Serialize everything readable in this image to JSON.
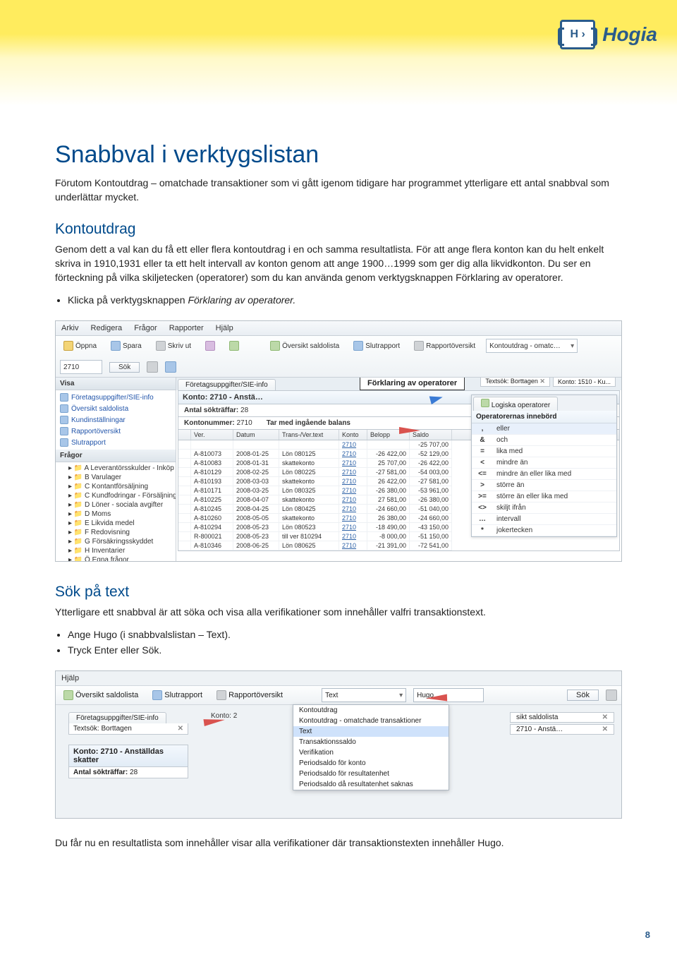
{
  "logo": {
    "brand": "Hogia",
    "mark": "H ›"
  },
  "page_number": "8",
  "h1": "Snabbval i verktygslistan",
  "intro": "Förutom Kontoutdrag – omatchade transaktioner som vi gått igenom tidigare har programmet ytterligare ett antal snabbval som underlättar mycket.",
  "sec1": {
    "heading": "Kontoutdrag",
    "para": "Genom dett a val kan du få ett eller flera kontoutdrag i en och samma resultatlista. För att ange flera konton kan du helt enkelt skriva in 1910,1931 eller ta ett helt intervall av konton genom att ange 1900…1999 som ger dig alla likvidkonton. Du ser en förteckning på vilka skiljetecken (operatorer) som du kan använda genom verktygsknappen Förklaring av operatorer.",
    "bullet1": "Klicka på verktygsknappen ",
    "bullet1_em": "Förklaring av operatorer."
  },
  "ss1": {
    "menu": {
      "m1": "Arkiv",
      "m2": "Redigera",
      "m3": "Frågor",
      "m4": "Rapporter",
      "m5": "Hjälp"
    },
    "tool": {
      "oppna": "Öppna",
      "spara": "Spara",
      "skriv": "Skriv ut",
      "over": "Översikt saldolista",
      "slut": "Slutrapport",
      "rap": "Rapportöversikt",
      "combo": "Kontoutdrag - omatc…",
      "combo2": "2710",
      "sok": "Sök"
    },
    "strip": {
      "textsok": "Textsök: Borttagen",
      "konto": "Konto: 1510 - Ku..."
    },
    "callout": "Förklaring av operatorer",
    "side_h1": "Visa",
    "side_items": [
      "Företagsuppgifter/SIE-info",
      "Översikt saldolista",
      "Kundinställningar",
      "Rapportöversikt",
      "Slutrapport"
    ],
    "side_h2": "Frågor",
    "tree": [
      "A Leverantörsskulder - Inköp",
      "B Varulager",
      "C Kontantförsäljning",
      "C Kundfodringar - Försäljning",
      "D Löner - sociala avgifter",
      "D Moms",
      "E Likvida medel",
      "F Redovisning",
      "G Försäkringsskyddet",
      "H Inventarier",
      "Ö Egna frågor"
    ],
    "tab": "Företagsuppgifter/SIE-info",
    "konto_head": "Konto: 2710 - Anstä…",
    "antal_lbl": "Antal sökträffar:",
    "antal_val": "28",
    "kontonummer_lbl": "Kontonummer:",
    "kontonummer_val": "2710",
    "tarmed": "Tar med ingående balans",
    "cols": [
      "",
      "Ver.",
      "Datum",
      "Trans-/Ver.text",
      "Konto",
      "Belopp",
      "Saldo"
    ],
    "rows": [
      [
        "",
        "",
        "",
        "",
        "2710",
        "",
        "-25 707,00"
      ],
      [
        "",
        "A-810073",
        "2008-01-25",
        "Lön 080125",
        "2710",
        "-26 422,00",
        "-52 129,00"
      ],
      [
        "",
        "A-810083",
        "2008-01-31",
        "skattekonto",
        "2710",
        "25 707,00",
        "-26 422,00"
      ],
      [
        "",
        "A-810129",
        "2008-02-25",
        "Lön 080225",
        "2710",
        "-27 581,00",
        "-54 003,00"
      ],
      [
        "",
        "A-810193",
        "2008-03-03",
        "skattekonto",
        "2710",
        "26 422,00",
        "-27 581,00"
      ],
      [
        "",
        "A-810171",
        "2008-03-25",
        "Lön 080325",
        "2710",
        "-26 380,00",
        "-53 961,00"
      ],
      [
        "",
        "A-810225",
        "2008-04-07",
        "skattekonto",
        "2710",
        "27 581,00",
        "-26 380,00"
      ],
      [
        "",
        "A-810245",
        "2008-04-25",
        "Lön 080425",
        "2710",
        "-24 660,00",
        "-51 040,00"
      ],
      [
        "",
        "A-810260",
        "2008-05-05",
        "skattekonto",
        "2710",
        "26 380,00",
        "-24 660,00"
      ],
      [
        "",
        "A-810294",
        "2008-05-23",
        "Lön 080523",
        "2710",
        "-18 490,00",
        "-43 150,00"
      ],
      [
        "",
        "R-800021",
        "2008-05-23",
        "till ver 810294",
        "2710",
        "-8 000,00",
        "-51 150,00"
      ],
      [
        "",
        "A-810346",
        "2008-06-25",
        "Lön 080625",
        "2710",
        "-21 391,00",
        "-72 541,00"
      ]
    ],
    "op_tab": "Logiska operatorer",
    "op_head": "Operatorernas innebörd",
    "ops": [
      [
        ",",
        "eller"
      ],
      [
        "&",
        "och"
      ],
      [
        "=",
        "lika med"
      ],
      [
        "<",
        "mindre än"
      ],
      [
        "<=",
        "mindre än eller lika med"
      ],
      [
        ">",
        "större än"
      ],
      [
        ">=",
        "större än eller lika med"
      ],
      [
        "<>",
        "skiljt ifrån"
      ],
      [
        "…",
        "intervall"
      ],
      [
        "*",
        "jokertecken"
      ]
    ]
  },
  "sec2": {
    "heading": "Sök på text",
    "para": "Ytterligare ett snabbval är att söka och visa alla verifikationer som innehåller valfri transaktionstext.",
    "b1": "Ange Hugo (i snabbvalslistan – Text).",
    "b2": "Tryck Enter eller Sök."
  },
  "ss2": {
    "menu": "Hjälp",
    "tool": {
      "over": "Översikt saldolista",
      "slut": "Slutrapport",
      "rap": "Rapportöversikt",
      "text": "Text",
      "hugo": "Hugo",
      "sok": "Sök"
    },
    "pop": [
      "Kontoutdrag",
      "Kontoutdrag - omatchade transaktioner",
      "Text",
      "Transaktionssaldo",
      "Verifikation",
      "Periodsaldo för konto",
      "Periodsaldo för resultatenhet",
      "Periodsaldo då resultatenhet saknas"
    ],
    "leftTab": "Företagsuppgifter/SIE-info",
    "leftLine": "Textsök: Borttagen",
    "midTop": "Konto: 2",
    "khead": "Konto: 2710 - Anställdas skatter",
    "antal_lbl": "Antal sökträffar:",
    "antal_val": "28",
    "right": [
      "sikt saldolista",
      "2710 - Anstä…"
    ]
  },
  "closing": "Du får nu en resultatlista som innehåller visar alla verifikationer där transaktionstexten innehåller Hugo."
}
